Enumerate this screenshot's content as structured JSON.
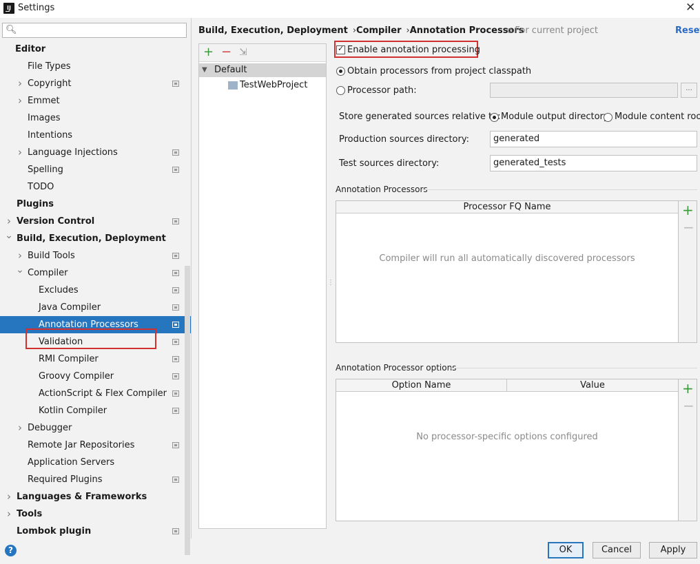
{
  "window": {
    "title": "Settings",
    "logo": "IJ"
  },
  "search": {
    "placeholder": ""
  },
  "tree": [
    {
      "label": "Editor",
      "bold": true
    },
    {
      "label": "File Types"
    },
    {
      "label": "Copyright",
      "arrow": true,
      "proj": true
    },
    {
      "label": "Emmet",
      "arrow": true
    },
    {
      "label": "Images"
    },
    {
      "label": "Intentions"
    },
    {
      "label": "Language Injections",
      "arrow": true,
      "proj": true
    },
    {
      "label": "Spelling",
      "proj": true
    },
    {
      "label": "TODO"
    },
    {
      "label": "Plugins",
      "bold": true
    },
    {
      "label": "Version Control",
      "bold": true,
      "arrow": true,
      "proj": true
    },
    {
      "label": "Build, Execution, Deployment",
      "bold": true,
      "arrow": true,
      "expanded": true
    },
    {
      "label": "Build Tools",
      "arrow": true,
      "proj": true
    },
    {
      "label": "Compiler",
      "arrow": true,
      "expanded": true,
      "proj": true
    },
    {
      "label": "Excludes",
      "proj": true
    },
    {
      "label": "Java Compiler",
      "proj": true
    },
    {
      "label": "Annotation Processors",
      "proj": true,
      "selected": true
    },
    {
      "label": "Validation",
      "proj": true
    },
    {
      "label": "RMI Compiler",
      "proj": true
    },
    {
      "label": "Groovy Compiler",
      "proj": true
    },
    {
      "label": "ActionScript & Flex Compiler",
      "proj": true
    },
    {
      "label": "Kotlin Compiler",
      "proj": true
    },
    {
      "label": "Debugger",
      "arrow": true
    },
    {
      "label": "Remote Jar Repositories",
      "proj": true
    },
    {
      "label": "Application Servers"
    },
    {
      "label": "Required Plugins",
      "proj": true
    },
    {
      "label": "Languages & Frameworks",
      "bold": true,
      "arrow": true
    },
    {
      "label": "Tools",
      "bold": true,
      "arrow": true
    },
    {
      "label": "Lombok plugin",
      "bold": true,
      "proj": true
    }
  ],
  "breadcrumb": {
    "part1": "Build, Execution, Deployment",
    "sep": "›",
    "part2": "Compiler",
    "part3": "Annotation Processors"
  },
  "scope": "For current project",
  "reset": "Reset",
  "profiles": {
    "default": "Default",
    "project": "TestWebProject"
  },
  "form": {
    "enable": "Enable annotation processing",
    "obtain_classpath": "Obtain processors from project classpath",
    "processor_path": "Processor path:",
    "processor_path_value": "",
    "browse": "...",
    "store_label": "Store generated sources relative to:",
    "module_output": "Module output directory",
    "module_content": "Module content root",
    "prod_label": "Production sources directory:",
    "prod_value": "generated",
    "test_label": "Test sources directory:",
    "test_value": "generated_tests"
  },
  "processors": {
    "section": "Annotation Processors",
    "column": "Processor FQ Name",
    "empty": "Compiler will run all automatically discovered processors"
  },
  "options": {
    "section": "Annotation Processor options",
    "col_name": "Option Name",
    "col_value": "Value",
    "empty": "No processor-specific options configured"
  },
  "buttons": {
    "help": "?",
    "ok": "OK",
    "cancel": "Cancel",
    "apply": "Apply"
  },
  "colors": {
    "selection": "#2675bf",
    "highlight_box": "#d32f2f",
    "link": "#2a6bc8"
  }
}
